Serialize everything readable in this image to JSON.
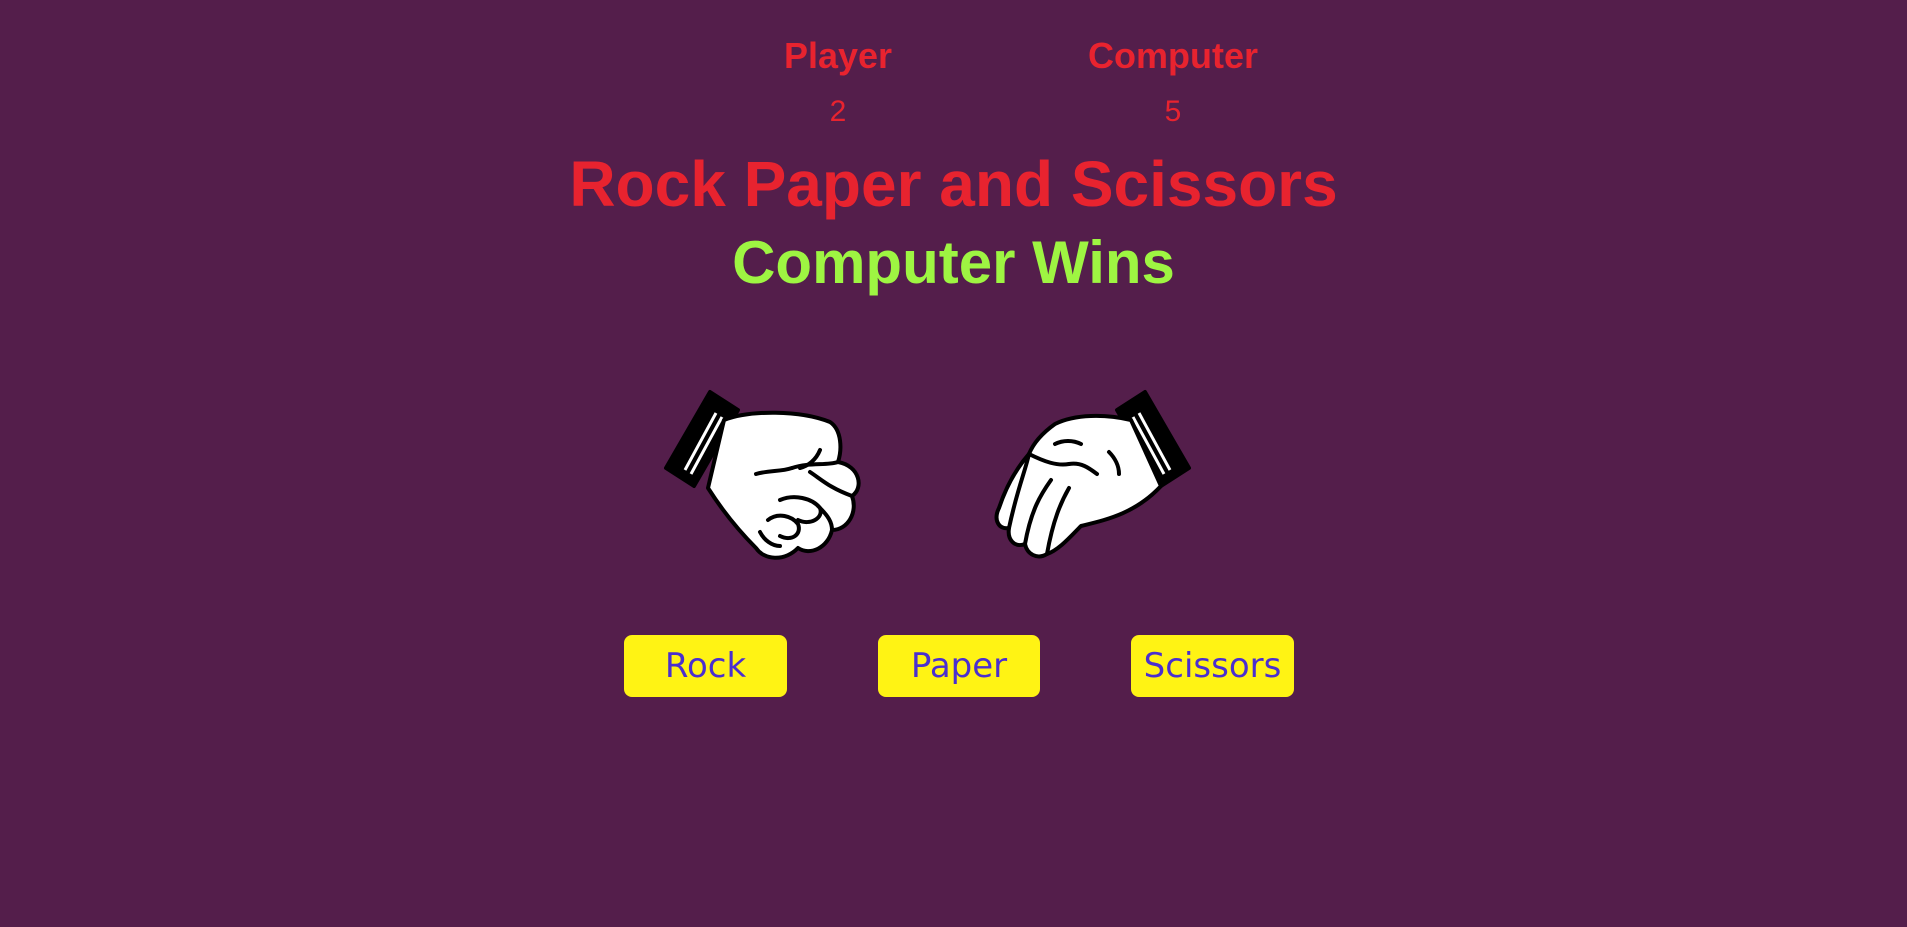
{
  "scoreboard": {
    "player_label": "Player",
    "player_score": "2",
    "computer_label": "Computer",
    "computer_score": "5"
  },
  "title": "Rock Paper and Scissors",
  "result": "Computer Wins",
  "hands": {
    "player_choice_icon": "rock-fist-icon",
    "computer_choice_icon": "paper-open-hand-icon"
  },
  "buttons": {
    "rock": "Rock",
    "paper": "Paper",
    "scissors": "Scissors"
  },
  "colors": {
    "background": "#541e4b",
    "title": "#e8232f",
    "result": "#9ef542",
    "button_bg": "#fff314",
    "button_text": "#4a2fcf"
  }
}
